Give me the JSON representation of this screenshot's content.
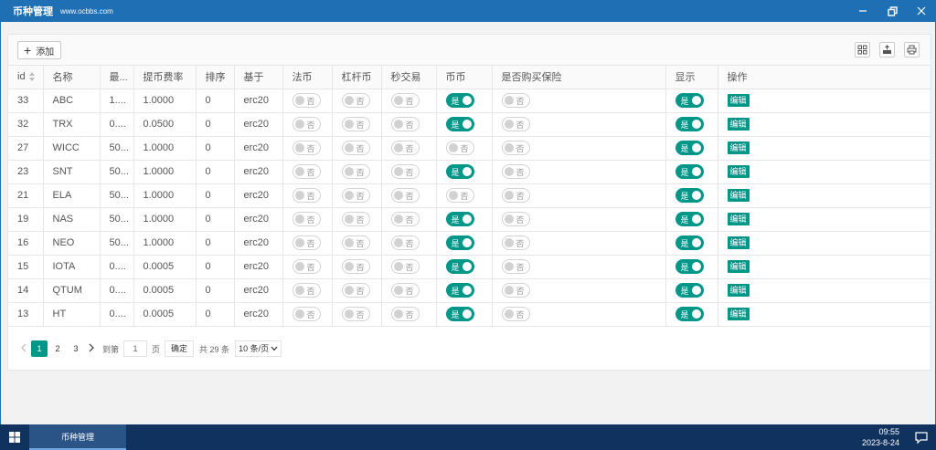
{
  "window": {
    "title": "币种管理",
    "url": "www.ocbbs.com"
  },
  "toolbar": {
    "add_label": "添加"
  },
  "columns": [
    "id",
    "名称",
    "最...",
    "提币费率",
    "排序",
    "基于",
    "法币",
    "杠杆币",
    "秒交易",
    "币币",
    "是否购买保险",
    "显示",
    "操作"
  ],
  "switch_labels": {
    "on": "是",
    "off": "否"
  },
  "edit_label": "编辑",
  "rows": [
    {
      "id": "33",
      "name": "ABC",
      "min": "1....",
      "fee": "1.0000",
      "sort": "0",
      "base": "erc20",
      "fiat": false,
      "leverage": false,
      "second": false,
      "coin": true,
      "insurance": false,
      "show": true
    },
    {
      "id": "32",
      "name": "TRX",
      "min": "0....",
      "fee": "0.0500",
      "sort": "0",
      "base": "erc20",
      "fiat": false,
      "leverage": false,
      "second": false,
      "coin": true,
      "insurance": false,
      "show": true
    },
    {
      "id": "27",
      "name": "WICC",
      "min": "50...",
      "fee": "1.0000",
      "sort": "0",
      "base": "erc20",
      "fiat": false,
      "leverage": false,
      "second": false,
      "coin": false,
      "insurance": false,
      "show": true
    },
    {
      "id": "23",
      "name": "SNT",
      "min": "50...",
      "fee": "1.0000",
      "sort": "0",
      "base": "erc20",
      "fiat": false,
      "leverage": false,
      "second": false,
      "coin": true,
      "insurance": false,
      "show": true
    },
    {
      "id": "21",
      "name": "ELA",
      "min": "50...",
      "fee": "1.0000",
      "sort": "0",
      "base": "erc20",
      "fiat": false,
      "leverage": false,
      "second": false,
      "coin": false,
      "insurance": false,
      "show": true
    },
    {
      "id": "19",
      "name": "NAS",
      "min": "50...",
      "fee": "1.0000",
      "sort": "0",
      "base": "erc20",
      "fiat": false,
      "leverage": false,
      "second": false,
      "coin": true,
      "insurance": false,
      "show": true
    },
    {
      "id": "16",
      "name": "NEO",
      "min": "50...",
      "fee": "1.0000",
      "sort": "0",
      "base": "erc20",
      "fiat": false,
      "leverage": false,
      "second": false,
      "coin": true,
      "insurance": false,
      "show": true
    },
    {
      "id": "15",
      "name": "IOTA",
      "min": "0....",
      "fee": "0.0005",
      "sort": "0",
      "base": "erc20",
      "fiat": false,
      "leverage": false,
      "second": false,
      "coin": true,
      "insurance": false,
      "show": true
    },
    {
      "id": "14",
      "name": "QTUM",
      "min": "0....",
      "fee": "0.0005",
      "sort": "0",
      "base": "erc20",
      "fiat": false,
      "leverage": false,
      "second": false,
      "coin": true,
      "insurance": false,
      "show": true
    },
    {
      "id": "13",
      "name": "HT",
      "min": "0....",
      "fee": "0.0005",
      "sort": "0",
      "base": "erc20",
      "fiat": false,
      "leverage": false,
      "second": false,
      "coin": true,
      "insurance": false,
      "show": true
    }
  ],
  "pagination": {
    "pages": [
      "1",
      "2",
      "3"
    ],
    "current": "1",
    "goto_label": "到第",
    "goto_value": "1",
    "page_unit": "页",
    "confirm_label": "确定",
    "total_label": "共 29 条",
    "page_size": "10 条/页"
  },
  "taskbar": {
    "item_label": "币种管理",
    "time": "09:55",
    "date": "2023-8-24"
  },
  "colors": {
    "titlebar": "#1f6fb5",
    "accent": "#009688",
    "taskbar": "#10325e"
  }
}
